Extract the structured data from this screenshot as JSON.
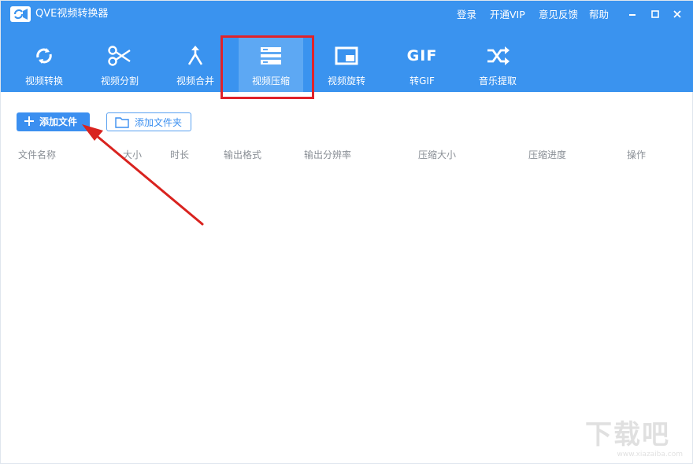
{
  "app": {
    "title": "QVE视频转换器",
    "accent_color": "#3a93ef",
    "active_tab_color": "#5da8f3"
  },
  "titlebar": {
    "links": [
      "登录",
      "开通VIP",
      "意见反馈",
      "帮助"
    ],
    "window_controls": [
      "minimize-icon",
      "maximize-icon",
      "close-icon"
    ]
  },
  "toolbar": {
    "tabs": [
      {
        "label": "视频转换",
        "icon": "refresh-icon",
        "active": false
      },
      {
        "label": "视频分割",
        "icon": "scissors-icon",
        "active": false
      },
      {
        "label": "视频合并",
        "icon": "merge-icon",
        "active": false
      },
      {
        "label": "视频压缩",
        "icon": "compress-icon",
        "active": true
      },
      {
        "label": "视频旋转",
        "icon": "rotate-icon",
        "active": false
      },
      {
        "label": "转GIF",
        "icon": "gif-icon",
        "icon_text": "GIF",
        "active": false
      },
      {
        "label": "音乐提取",
        "icon": "shuffle-icon",
        "active": false
      }
    ]
  },
  "actions": {
    "add_file": "添加文件",
    "add_folder": "添加文件夹"
  },
  "table": {
    "columns": [
      "文件名称",
      "大小",
      "时长",
      "输出格式",
      "输出分辨率",
      "压缩大小",
      "压缩进度",
      "操作"
    ],
    "rows": []
  },
  "annotation": {
    "highlight_color": "#e0222a"
  },
  "watermark": {
    "text": "下载吧",
    "url": "www.xiazaiba.com"
  }
}
